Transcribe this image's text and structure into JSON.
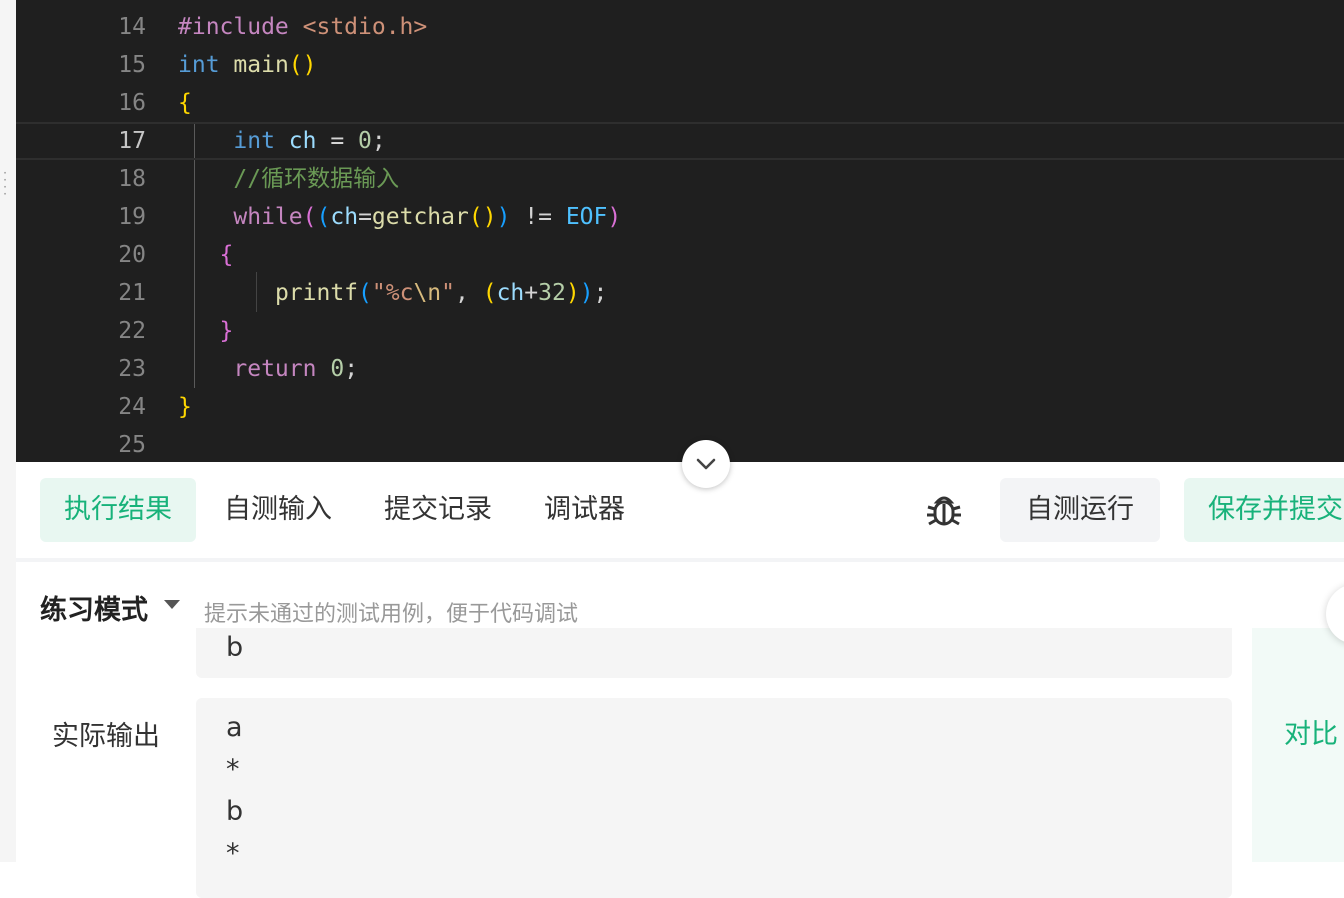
{
  "editor": {
    "lines": [
      {
        "n": "14",
        "tokens": [
          {
            "t": "#include ",
            "c": "c-pre"
          },
          {
            "t": "<stdio.h>",
            "c": "c-inc"
          }
        ]
      },
      {
        "n": "15",
        "tokens": [
          {
            "t": "int",
            "c": "c-kw"
          },
          {
            "t": " ",
            "c": "c-op"
          },
          {
            "t": "main",
            "c": "c-fn"
          },
          {
            "t": "()",
            "c": "b1"
          }
        ]
      },
      {
        "n": "16",
        "tokens": [
          {
            "t": "{",
            "c": "b1"
          }
        ]
      },
      {
        "n": "17",
        "tokens": [
          {
            "t": "    ",
            "c": "c-op"
          },
          {
            "t": "int",
            "c": "c-kw"
          },
          {
            "t": " ",
            "c": "c-op"
          },
          {
            "t": "ch",
            "c": "c-var"
          },
          {
            "t": " = ",
            "c": "c-op"
          },
          {
            "t": "0",
            "c": "c-num"
          },
          {
            "t": ";",
            "c": "c-op"
          }
        ]
      },
      {
        "n": "18",
        "tokens": [
          {
            "t": "    ",
            "c": "c-op"
          },
          {
            "t": "//循环数据输入",
            "c": "c-com"
          }
        ]
      },
      {
        "n": "19",
        "tokens": [
          {
            "t": "    ",
            "c": "c-op"
          },
          {
            "t": "while",
            "c": "c-ctl"
          },
          {
            "t": "(",
            "c": "b2"
          },
          {
            "t": "(",
            "c": "b3"
          },
          {
            "t": "ch",
            "c": "c-var"
          },
          {
            "t": "=",
            "c": "c-op"
          },
          {
            "t": "getchar",
            "c": "c-fn"
          },
          {
            "t": "()",
            "c": "b1"
          },
          {
            "t": ")",
            "c": "b3"
          },
          {
            "t": " != ",
            "c": "c-op"
          },
          {
            "t": "EOF",
            "c": "c-mac"
          },
          {
            "t": ")",
            "c": "b2"
          }
        ]
      },
      {
        "n": "20",
        "tokens": [
          {
            "t": "   ",
            "c": "c-op"
          },
          {
            "t": "{",
            "c": "b2"
          }
        ]
      },
      {
        "n": "21",
        "tokens": [
          {
            "t": "       ",
            "c": "c-op"
          },
          {
            "t": "printf",
            "c": "c-fn"
          },
          {
            "t": "(",
            "c": "b3"
          },
          {
            "t": "\"%c",
            "c": "c-str"
          },
          {
            "t": "\\n",
            "c": "c-esc"
          },
          {
            "t": "\"",
            "c": "c-str"
          },
          {
            "t": ", ",
            "c": "c-op"
          },
          {
            "t": "(",
            "c": "b1"
          },
          {
            "t": "ch",
            "c": "c-var"
          },
          {
            "t": "+",
            "c": "c-op"
          },
          {
            "t": "32",
            "c": "c-num"
          },
          {
            "t": ")",
            "c": "b1"
          },
          {
            "t": ")",
            "c": "b3"
          },
          {
            "t": ";",
            "c": "c-op"
          }
        ]
      },
      {
        "n": "22",
        "tokens": [
          {
            "t": "   ",
            "c": "c-op"
          },
          {
            "t": "}",
            "c": "b2"
          }
        ]
      },
      {
        "n": "23",
        "tokens": [
          {
            "t": "    ",
            "c": "c-op"
          },
          {
            "t": "return",
            "c": "c-ctl"
          },
          {
            "t": " ",
            "c": "c-op"
          },
          {
            "t": "0",
            "c": "c-num"
          },
          {
            "t": ";",
            "c": "c-op"
          }
        ]
      },
      {
        "n": "24",
        "tokens": [
          {
            "t": "}",
            "c": "b1"
          }
        ]
      },
      {
        "n": "25",
        "tokens": []
      }
    ],
    "active_line": "17"
  },
  "toolbar": {
    "tabs": [
      {
        "label": "执行结果",
        "active": true
      },
      {
        "label": "自测输入",
        "active": false
      },
      {
        "label": "提交记录",
        "active": false
      },
      {
        "label": "调试器",
        "active": false
      }
    ],
    "run_label": "自测运行",
    "submit_label": "保存并提交"
  },
  "result": {
    "mode_label": "练习模式",
    "mode_hint": "提示未通过的测试用例，便于代码调试",
    "expected_lines": [
      "b"
    ],
    "actual_label": "实际输出",
    "actual_lines": [
      "a",
      "*",
      "b",
      "*"
    ],
    "compare_label": "对比"
  },
  "colors": {
    "accent": "#18b27a",
    "editor_bg": "#1f1f1f"
  }
}
